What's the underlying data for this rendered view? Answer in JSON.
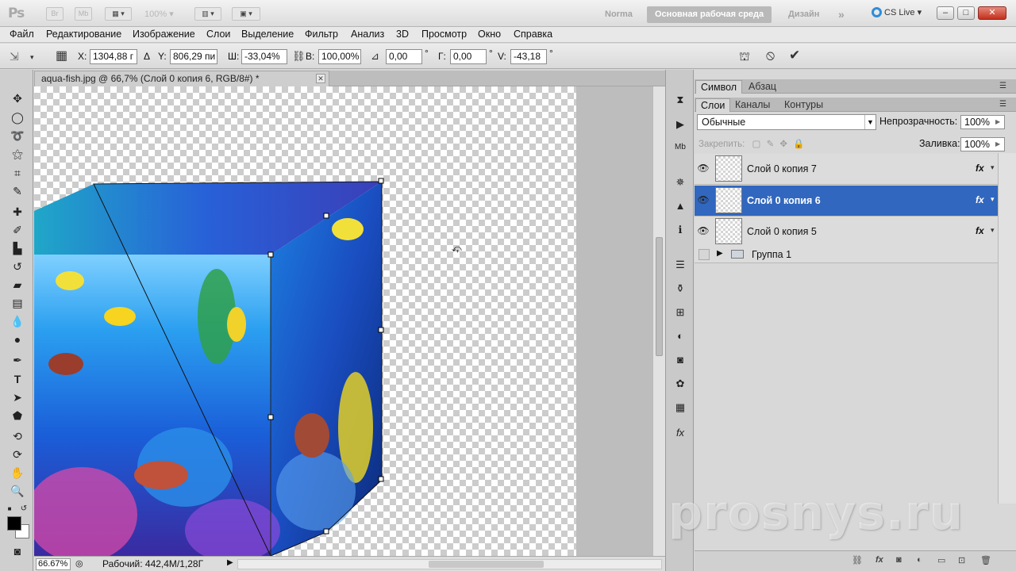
{
  "app": {
    "logo": "Ps"
  },
  "appbar": {
    "br_label": "Br",
    "mb_label": "Mb",
    "zoom": "100%",
    "workspaces": [
      "Norma",
      "Основная рабочая среда",
      "Дизайн"
    ],
    "more": "»",
    "cs_live": "CS Live",
    "win_min": "–",
    "win_max": "□",
    "win_close": "✕"
  },
  "menu": [
    "Файл",
    "Редактирование",
    "Изображение",
    "Слои",
    "Выделение",
    "Фильтр",
    "Анализ",
    "3D",
    "Просмотр",
    "Окно",
    "Справка"
  ],
  "options": {
    "x_label": "X:",
    "x_value": "1304,88 г",
    "delta": "Δ",
    "y_label": "Y:",
    "y_value": "806,29 пи",
    "w_label": "Ш:",
    "w_value": "-33,04%",
    "h_label": "В:",
    "h_value": "100,00%",
    "angle_value": "0,00",
    "deg": "°",
    "hs_label": "Г:",
    "hs_value": "0,00",
    "vs_label": "V:",
    "vs_value": "-43,18",
    "cancel": "⦸",
    "commit": "✔"
  },
  "document": {
    "tab_title": "aqua-fish.jpg @ 66,7% (Слой 0 копия 6, RGB/8#) *",
    "close": "✕",
    "zoom": "66.67%",
    "status": "Рабочий: 442,4M/1,28Г"
  },
  "panels": {
    "top_tabs": [
      "Символ",
      "Абзац"
    ],
    "layer_tabs": [
      "Слои",
      "Каналы",
      "Контуры"
    ],
    "blend_mode": "Обычные",
    "opacity_label": "Непрозрачность:",
    "opacity_value": "100%",
    "lock_label": "Закрепить:",
    "fill_label": "Заливка:",
    "fill_value": "100%",
    "layers": [
      {
        "name": "Слой 0 копия 7",
        "selected": false,
        "fx": "fx"
      },
      {
        "name": "Слой 0 копия 6",
        "selected": true,
        "fx": "fx"
      },
      {
        "name": "Слой 0 копия 5",
        "selected": false,
        "fx": "fx"
      }
    ],
    "group": "Группа 1"
  },
  "watermark": "prosnys.ru",
  "colors": {
    "selection_blue": "#3167be",
    "accent_blue": "#2e8dd8"
  }
}
